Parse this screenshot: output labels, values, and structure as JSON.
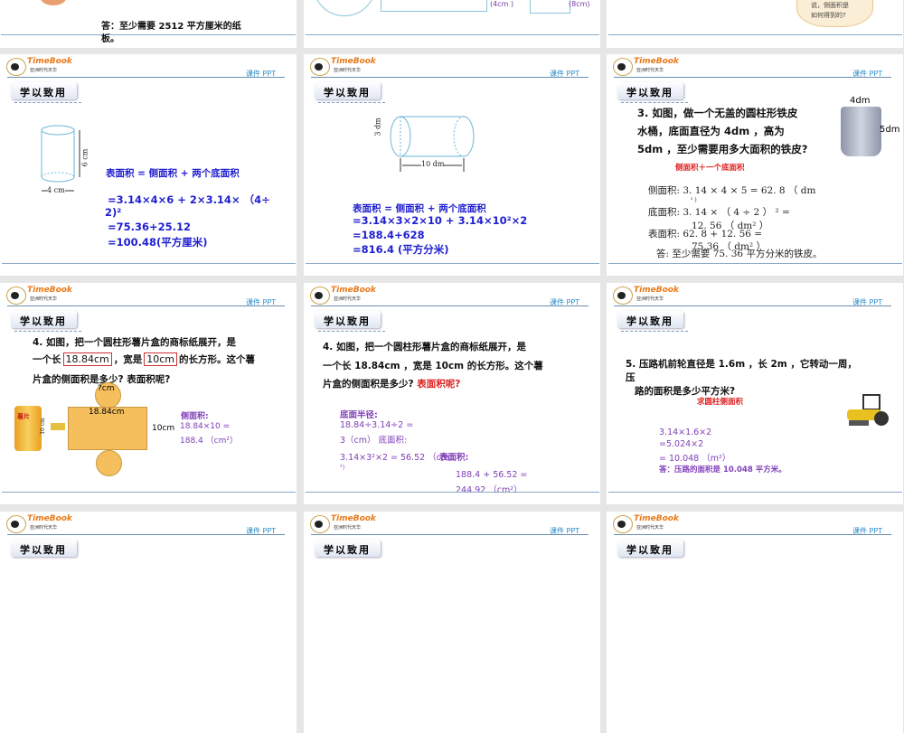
{
  "common": {
    "brand": "TimeBook",
    "brand_sub": "亚洲时代天华",
    "ppt_label": "课件 PPT",
    "section_badge": "学以致用"
  },
  "top_row": {
    "s1_answer": "答：至少需要 2512 平方厘米的纸",
    "s1_answer2": "板。",
    "s2_label_a": "(4cm )",
    "s2_label_b": "(8cm)",
    "s3_bubble1": "说，侧面积是",
    "s3_bubble2": "如何得到的?"
  },
  "slide_a": {
    "height": "6 cm",
    "width": "4 cm",
    "formula": "表面积 = 侧面积 + 两个底面积",
    "l1": "=3.14×4×6 + 2×3.14× （4÷",
    "l2": "2)²",
    "l3": "=75.36+25.12",
    "l4": "=100.48(平方厘米)"
  },
  "slide_b": {
    "radius": "3 dm",
    "length": "10 dm",
    "formula": "表面积 = 侧面积 + 两个底面积",
    "l1": "=3.14×3×2×10 + 3.14×10²×2",
    "l2": "=188.4+628",
    "l3": "=816.4 (平方分米)"
  },
  "slide_c": {
    "q1": "3. 如图，做一个无盖的圆柱形铁皮",
    "q2": "水桶，底面直径为 4dm ，高为",
    "q3": "5dm ，至少需要用多大面积的铁皮?",
    "diam": "4dm",
    "height": "5dm",
    "hint": "侧面积＋一个底面积",
    "l1": "侧面积: 3. 14 × 4 × 5 = 62. 8 （ dm",
    "l1b": "² )",
    "l2": "底面积: 3. 14 × （ 4 ÷ 2 ） ² =",
    "l2b": "12. 56 （ dm² ）",
    "l3": "表面积: 62. 8 + 12. 56 =",
    "l3b": "75.36 （ dm² ）",
    "ans": "答: 至少需要 75. 36 平方分米的铁皮。"
  },
  "slide_d": {
    "q1": "4. 如图，把一个圆柱形薯片盒的商标纸展开，是",
    "q2a": "一个长",
    "q2b": "18.84cm",
    "q2c": "，宽是",
    "q2d": "10cm",
    "q2e": "的长方形。这个薯",
    "q3": "片盒的侧面积是多少? 表面积呢?",
    "circle_label": "?cm",
    "rect_label": "18.84cm",
    "side_label": "10cm",
    "can_label": "薯片",
    "can_height": "10 cm",
    "r1": "侧面积:",
    "r2": "18.84×10 =",
    "r3": "188.4 （cm²）"
  },
  "slide_e": {
    "q1": "4. 如图，把一个圆柱形薯片盒的商标纸展开，是",
    "q2": "一个长 18.84cm ，宽是 10cm 的长方形。这个薯",
    "q3a": "片盒的侧面积是多少?",
    "q3b": "表面积呢?",
    "p1": "底面半径:",
    "p2": "18.84÷3.14÷2 =",
    "p3": "3（cm） 底面积:",
    "p4": "3.14×3²×2 = 56.52 （cm",
    "p4b": "²）",
    "p5": "表面积:",
    "p6": "188.4 + 56.52 =",
    "p7": "244.92 （cm²）"
  },
  "slide_f": {
    "q1": "5. 压路机前轮直径是 1.6m ，长 2m ，它转动一周，",
    "q1b": "压",
    "q2": "路的面积是多少平方米?",
    "hint": "求圆柱侧面积",
    "p1": "3.14×1.6×2",
    "p2": "=5.024×2",
    "p3": "= 10.048 （m²）",
    "p4": "答：压路的面积是 10.048 平方米。"
  }
}
